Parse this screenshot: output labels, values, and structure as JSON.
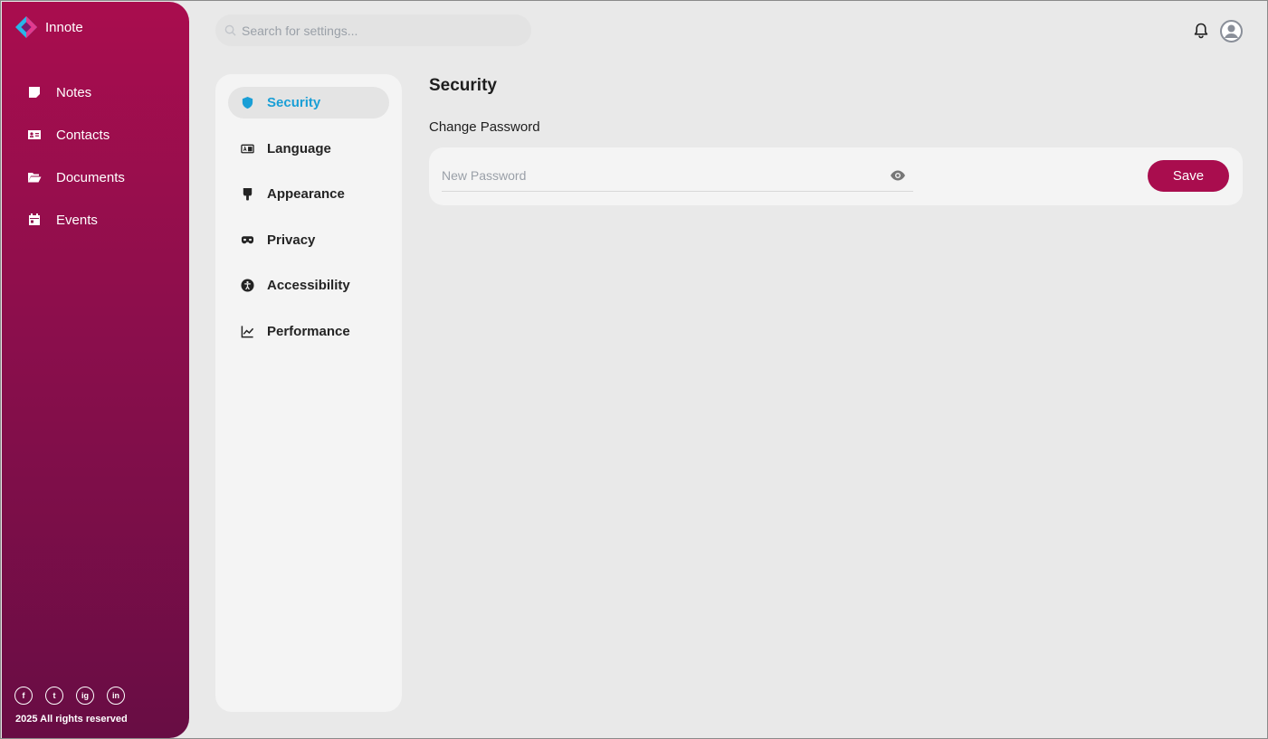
{
  "app": {
    "name": "Innote",
    "brand_color": "#a90d4e",
    "accent_color": "#1a9fd6"
  },
  "sidebar": {
    "items": [
      {
        "label": "Notes",
        "icon": "note-icon"
      },
      {
        "label": "Contacts",
        "icon": "contact-card-icon"
      },
      {
        "label": "Documents",
        "icon": "folder-open-icon"
      },
      {
        "label": "Events",
        "icon": "calendar-icon"
      }
    ],
    "socials": [
      {
        "label": "f",
        "icon": "facebook-icon"
      },
      {
        "label": "t",
        "icon": "twitter-icon"
      },
      {
        "label": "ig",
        "icon": "instagram-icon"
      },
      {
        "label": "in",
        "icon": "linkedin-icon"
      }
    ],
    "copyright": "2025 All rights reserved"
  },
  "search": {
    "placeholder": "Search for settings...",
    "value": ""
  },
  "header": {
    "notification_icon": "bell-icon",
    "avatar_icon": "user-avatar-icon"
  },
  "settings_nav": {
    "selected": "Security",
    "items": [
      {
        "label": "Security",
        "icon": "shield-icon"
      },
      {
        "label": "Language",
        "icon": "translate-icon"
      },
      {
        "label": "Appearance",
        "icon": "paintbrush-icon"
      },
      {
        "label": "Privacy",
        "icon": "mask-icon"
      },
      {
        "label": "Accessibility",
        "icon": "accessibility-icon"
      },
      {
        "label": "Performance",
        "icon": "line-chart-icon"
      }
    ]
  },
  "content": {
    "title": "Security",
    "subtitle": "Change Password",
    "password_placeholder": "New Password",
    "password_value": "",
    "save_label": "Save"
  }
}
